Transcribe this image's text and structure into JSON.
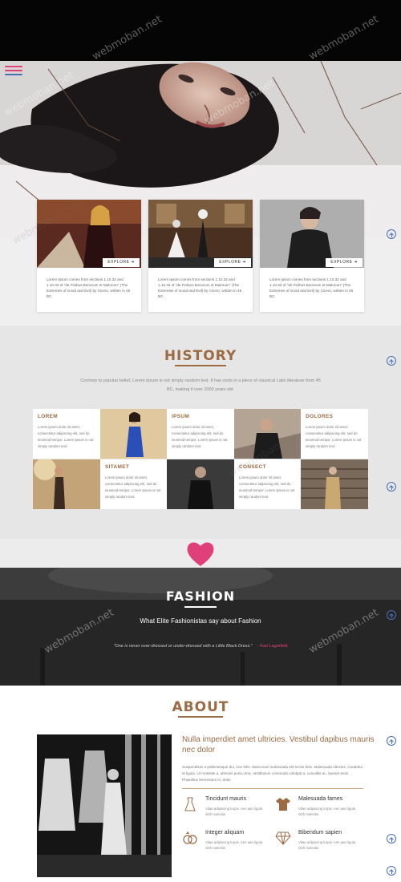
{
  "colors": {
    "accent": "#9b6b43",
    "link": "#4a6fb5",
    "heart": "#e0407a"
  },
  "watermark": "webmoban.net",
  "cards": [
    {
      "button": "EXPLORE",
      "button_icon": "arrow-right-icon",
      "text": "Lorem Ipsum comes from sections 1.10.32 and 1.10.33 of \"de Finibus Bonorum et Malorum\" (The Extremes of Good and Evil) by Cicero, written in 45 BC."
    },
    {
      "button": "EXPLORE",
      "button_icon": "arrow-right-icon",
      "text": "Lorem Ipsum comes from sections 1.10.32 and 1.10.33 of \"de Finibus Bonorum et Malorum\" (The Extremes of Good and Evil) by Cicero, written in 45 BC."
    },
    {
      "button": "EXPLORE",
      "button_icon": "arrow-right-icon",
      "text": "Lorem Ipsum comes from sections 1.10.32 and 1.10.33 of \"de Finibus Bonorum et Malorum\" (The Extremes of Good and Evil) by Cicero, written in 45 BC."
    }
  ],
  "history": {
    "title": "HISTORY",
    "description": "Contrary to popular belief, Lorem Ipsum is not simply random text. It has roots in a piece of classical Latin literature from 45 BC, making it over 2000 years old.",
    "items": [
      {
        "title": "LOREM",
        "text": "Lorem ipsum dolor sit amet, consectetur adipiscing elit, sed do eiusmod tempor. Lorem Ipsum is not simply random text."
      },
      {
        "title": "IPSUM",
        "text": "Lorem ipsum dolor sit amet, consectetur adipiscing elit, sed do eiusmod tempor. Lorem Ipsum is not simply random text."
      },
      {
        "title": "DOLORES",
        "text": "Lorem ipsum dolor sit amet, consectetur adipiscing elit, sed do eiusmod tempor. Lorem Ipsum is not simply random text."
      },
      {
        "title": "SITAMET",
        "text": "Lorem ipsum dolor sit amet, consectetur adipiscing elit, sed do eiusmod tempor. Lorem Ipsum is not simply random text."
      },
      {
        "title": "CONSECT",
        "text": "Lorem ipsum dolor sit amet, consectetur adipiscing elit, sed do eiusmod tempor. Lorem Ipsum is not simply random text."
      }
    ]
  },
  "fashion": {
    "title": "FASHION",
    "subtitle": "What Elite Fashionistas say about Fashion",
    "quote": "\"One is never over-dressed or under-dressed with a Little Black Dress.\"",
    "author": "- Karl Lagerfeld"
  },
  "about": {
    "title": "ABOUT",
    "heading": "Nulla imperdiet amet ultricies. Vestibul dapibus mauris nec dolor",
    "paragraph": "Suspendisse a pellentesque dui, non felis. Maecenas malesuada elit lectus felis. Malesuada ultricies. Curabitur et ligula. Ut molestie a, ultricies porta urna. Vestibulum commodo volutpat a, convallis ac, laoreet enim. Phasellus fermentum in, dolor.",
    "features": [
      {
        "icon": "dress-icon",
        "title": "Tincidunt mauris",
        "text": "Vitae adipiscing turpis. Aen aan ligula nibh molestie"
      },
      {
        "icon": "shirt-icon",
        "title": "Malesuada fames",
        "text": "Vitae adipiscing turpis. Aen aan ligula nibh molestie"
      },
      {
        "icon": "rings-icon",
        "title": "Integer aliquam",
        "text": "Vitae adipiscing turpis. Aen aan ligula nibh molestie"
      },
      {
        "icon": "diamond-icon",
        "title": "Bibendum sapien",
        "text": "Vitae adipiscing turpis. Aen aan ligula nibh molestie"
      }
    ]
  }
}
